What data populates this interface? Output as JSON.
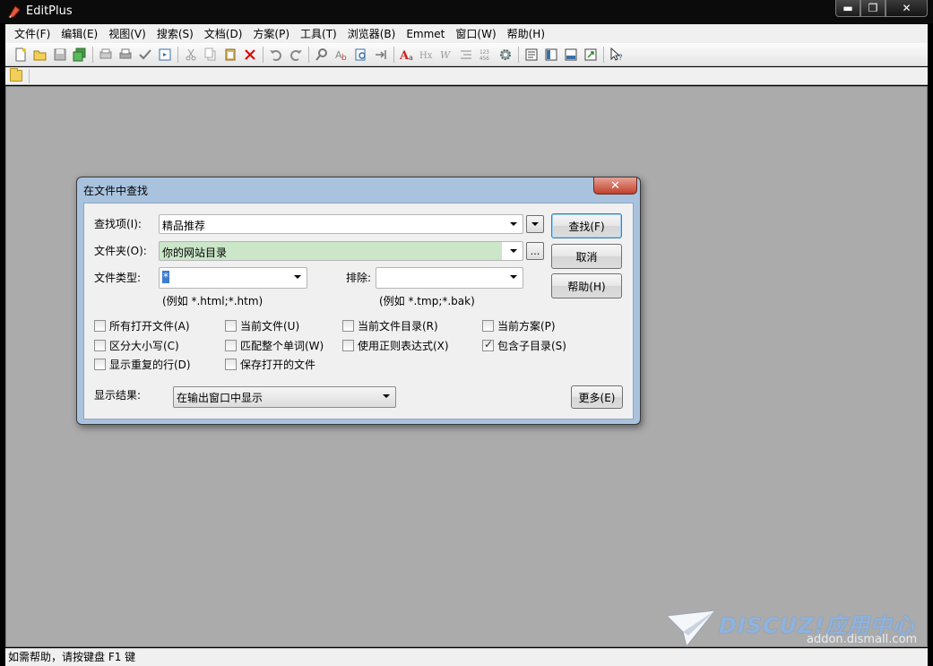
{
  "window": {
    "title": "EditPlus",
    "controls": {
      "minimize": "▬",
      "maximize": "❐",
      "close": "✕"
    }
  },
  "menu": [
    "文件(F)",
    "编辑(E)",
    "视图(V)",
    "搜索(S)",
    "文档(D)",
    "方案(P)",
    "工具(T)",
    "浏览器(B)",
    "Emmet",
    "窗口(W)",
    "帮助(H)"
  ],
  "toolbar_icons": [
    "new-file-icon",
    "open-icon",
    "save-icon",
    "save-all-icon",
    "print-preview-icon",
    "print-icon",
    "spell-check-icon",
    "browser-icon",
    "cut-icon",
    "copy-icon",
    "paste-icon",
    "delete-icon",
    "undo-icon",
    "redo-icon",
    "find-icon",
    "replace-icon",
    "find-in-files-icon",
    "goto-icon",
    "font-icon",
    "hex-icon",
    "word-wrap-icon",
    "indent-icon",
    "line-number-icon",
    "settings-icon",
    "cliptext-icon",
    "directory-icon",
    "output-icon",
    "fullscreen-icon",
    "help-pointer-icon"
  ],
  "status": "如需帮助，请按键盘 F1 键",
  "watermark": {
    "brand": "DISCUZ!应用中心",
    "url": "addon.dismall.com"
  },
  "dialog": {
    "title": "在文件中查找",
    "close": "✕",
    "find_label": "查找项(I):",
    "find_value": "精品推荐",
    "folder_label": "文件夹(O):",
    "folder_value": "你的网站目录",
    "browse": "...",
    "type_label": "文件类型:",
    "type_value": "*",
    "type_hint": "(例如 *.html;*.htm)",
    "exclude_label": "排除:",
    "exclude_value": "",
    "exclude_hint": "(例如 *.tmp;*.bak)",
    "buttons": {
      "find": "查找(F)",
      "cancel": "取消",
      "help": "帮助(H)",
      "more": "更多(E)"
    },
    "checkboxes": [
      {
        "label": "所有打开文件(A)",
        "checked": false
      },
      {
        "label": "当前文件(U)",
        "checked": false
      },
      {
        "label": "当前文件目录(R)",
        "checked": false
      },
      {
        "label": "当前方案(P)",
        "checked": false
      },
      {
        "label": "区分大小写(C)",
        "checked": false
      },
      {
        "label": "匹配整个单词(W)",
        "checked": false
      },
      {
        "label": "使用正则表达式(X)",
        "checked": false
      },
      {
        "label": "包含子目录(S)",
        "checked": true
      },
      {
        "label": "显示重复的行(D)",
        "checked": false
      },
      {
        "label": "保存打开的文件",
        "checked": false
      }
    ],
    "result_label": "显示结果:",
    "result_value": "在输出窗口中显示"
  }
}
